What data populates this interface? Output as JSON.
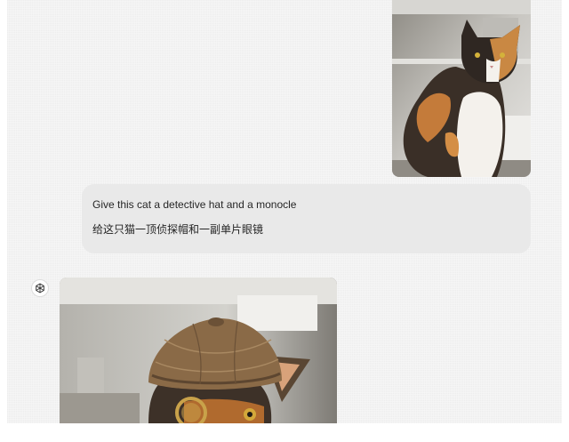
{
  "conversation": {
    "user_message": {
      "image_icon": "calico-cat-photo",
      "line_en": "Give this cat a detective hat and a monocle",
      "line_zh": "给这只猫一顶侦探帽和一副单片眼镜"
    },
    "assistant_message": {
      "avatar_icon": "openai-logo-icon",
      "image_icon": "cat-in-deerstalker-hat-with-monocle"
    }
  },
  "colors": {
    "panel_background": "#f3f3f3",
    "bubble_background": "#e9e9e9",
    "text": "#262626"
  }
}
